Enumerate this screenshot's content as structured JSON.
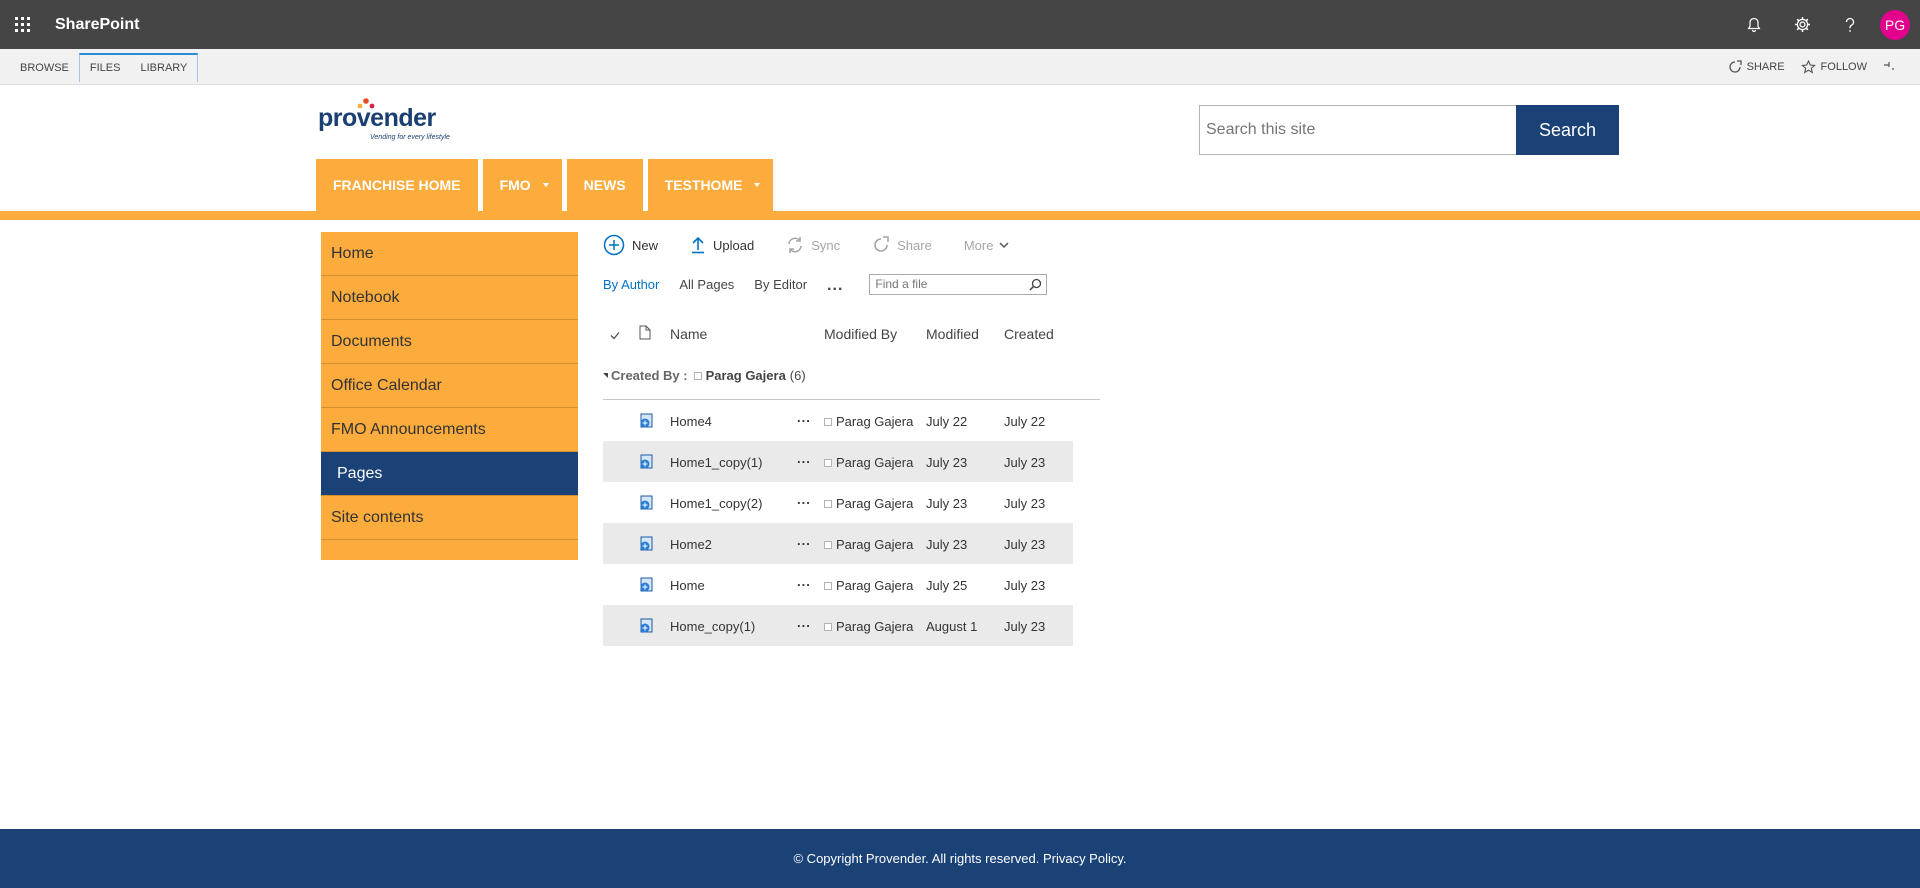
{
  "suite": {
    "title": "SharePoint",
    "avatar_initials": "PG",
    "avatar_color": "#e3008c"
  },
  "ribbon": {
    "tabs": [
      "BROWSE",
      "FILES",
      "LIBRARY"
    ],
    "share_label": "SHARE",
    "follow_label": "FOLLOW"
  },
  "header": {
    "logo_text": "provender",
    "logo_tagline": "Vending for every lifestyle",
    "search_placeholder": "Search this site",
    "search_button": "Search"
  },
  "topnav": {
    "items": [
      {
        "label": "FRANCHISE HOME",
        "has_dropdown": false
      },
      {
        "label": "FMO",
        "has_dropdown": true
      },
      {
        "label": "NEWS",
        "has_dropdown": false
      },
      {
        "label": "TESTHOME",
        "has_dropdown": true
      }
    ]
  },
  "leftnav": {
    "items": [
      {
        "label": "Home",
        "active": false
      },
      {
        "label": "Notebook",
        "active": false
      },
      {
        "label": "Documents",
        "active": false
      },
      {
        "label": "Office Calendar",
        "active": false
      },
      {
        "label": "FMO Announcements",
        "active": false
      },
      {
        "label": "Pages",
        "active": true
      },
      {
        "label": "Site contents",
        "active": false
      }
    ]
  },
  "commands": {
    "new": "New",
    "upload": "Upload",
    "sync": "Sync",
    "share": "Share",
    "more": "More"
  },
  "views": {
    "items": [
      "By Author",
      "All Pages",
      "By Editor"
    ],
    "active": "By Author",
    "more": "...",
    "find_placeholder": "Find a file"
  },
  "list": {
    "columns": {
      "name": "Name",
      "modified_by": "Modified By",
      "modified": "Modified",
      "created": "Created"
    },
    "group": {
      "label": "Created By :",
      "author": "Parag Gajera",
      "count": "(6)"
    },
    "rows": [
      {
        "name": "Home4",
        "modified_by": "Parag Gajera",
        "modified": "July 22",
        "created": "July 22"
      },
      {
        "name": "Home1_copy(1)",
        "modified_by": "Parag Gajera",
        "modified": "July 23",
        "created": "July 23"
      },
      {
        "name": "Home1_copy(2)",
        "modified_by": "Parag Gajera",
        "modified": "July 23",
        "created": "July 23"
      },
      {
        "name": "Home2",
        "modified_by": "Parag Gajera",
        "modified": "July 23",
        "created": "July 23"
      },
      {
        "name": "Home",
        "modified_by": "Parag Gajera",
        "modified": "July 25",
        "created": "July 23"
      },
      {
        "name": "Home_copy(1)",
        "modified_by": "Parag Gajera",
        "modified": "August 1",
        "created": "July 23"
      }
    ],
    "row_menu": "..."
  },
  "footer": {
    "text": "© Copyright Provender. All rights reserved. Privacy Policy."
  },
  "colors": {
    "brand_orange": "#fcac3d",
    "brand_blue": "#1a4277",
    "suite_bar": "#454545",
    "link_blue": "#0072c6"
  }
}
